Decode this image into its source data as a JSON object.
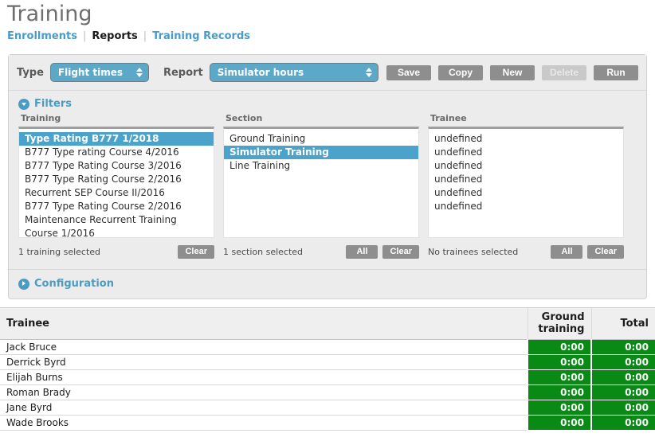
{
  "header": {
    "title": "Training",
    "nav": [
      {
        "label": "Enrollments",
        "active": false
      },
      {
        "label": "Reports",
        "active": true
      },
      {
        "label": "Training Records",
        "active": false
      }
    ],
    "nav_separator": "|"
  },
  "toolbar": {
    "type_label": "Type",
    "type_value": "Flight times",
    "report_label": "Report",
    "report_value": "Simulator hours",
    "save_label": "Save",
    "copy_label": "Copy",
    "new_label": "New",
    "delete_label": "Delete",
    "run_label": "Run"
  },
  "filters": {
    "title": "Filters",
    "training": {
      "title": "Training",
      "items": [
        "Type Rating B777 1/2018",
        "B777 Type rating Course 4/2016",
        "B777 Type Rating Course 3/2016",
        "B777 Type Rating Course 2/2016",
        "Recurrent SEP Course II/2016",
        "B777 Type Rating Course 2/2016",
        "Maintenance Recurrent Training Course 1/2016"
      ],
      "selected_index": 0,
      "status": "1 training selected",
      "clear_label": "Clear"
    },
    "section": {
      "title": "Section",
      "items": [
        "Ground Training",
        "Simulator Training",
        "Line Training"
      ],
      "selected_index": 1,
      "status": "1 section selected",
      "all_label": "All",
      "clear_label": "Clear"
    },
    "trainee": {
      "title": "Trainee",
      "items": [
        "undefined",
        "undefined",
        "undefined",
        "undefined",
        "undefined",
        "undefined"
      ],
      "selected_index": -1,
      "status": "No trainees selected",
      "all_label": "All",
      "clear_label": "Clear"
    }
  },
  "configuration": {
    "title": "Configuration"
  },
  "results": {
    "columns": [
      "Trainee",
      "Ground training",
      "Total"
    ],
    "rows": [
      {
        "trainee": "Jack Bruce",
        "ground_training": "0:00",
        "total": "0:00"
      },
      {
        "trainee": "Derrick Byrd",
        "ground_training": "0:00",
        "total": "0:00"
      },
      {
        "trainee": "Elijah Burns",
        "ground_training": "0:00",
        "total": "0:00"
      },
      {
        "trainee": "Roman Brady",
        "ground_training": "0:00",
        "total": "0:00"
      },
      {
        "trainee": "Jane Byrd",
        "ground_training": "0:00",
        "total": "0:00"
      },
      {
        "trainee": "Wade Brooks",
        "ground_training": "0:00",
        "total": "0:00"
      }
    ]
  },
  "colors": {
    "accent": "#4b9cc4",
    "select_blue": "#5ca8c8",
    "selection_blue": "#4ba3cc",
    "value_green": "#088a15",
    "button_gray": "#8e8e8e",
    "panel_gray": "#ececec"
  }
}
